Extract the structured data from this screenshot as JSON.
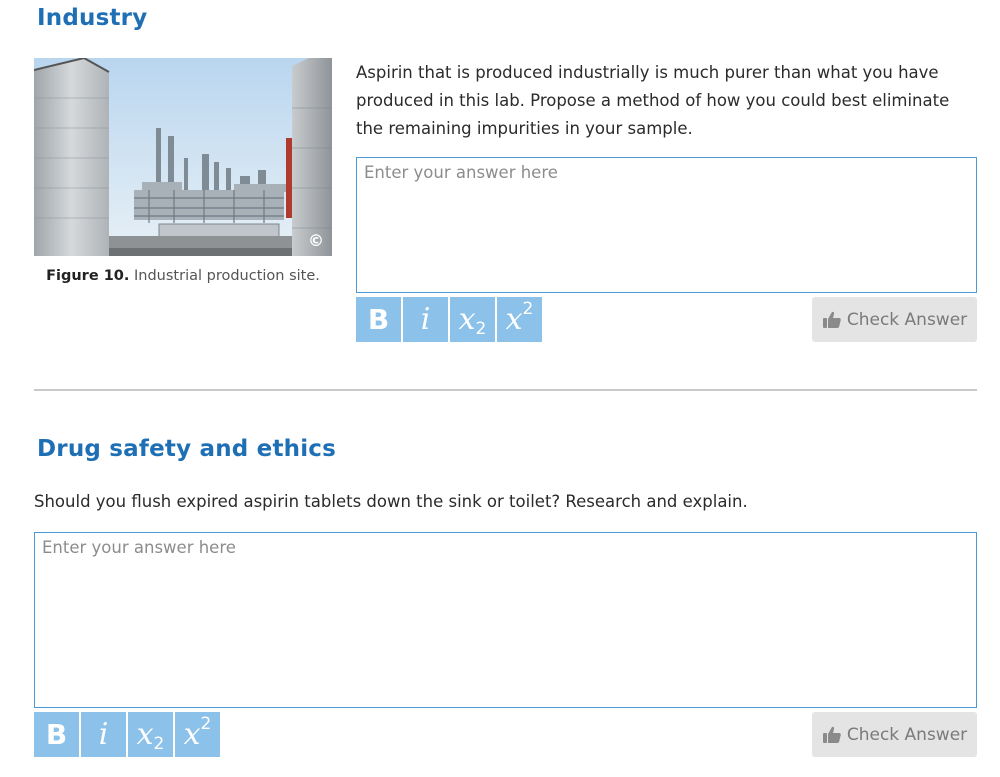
{
  "industry": {
    "heading": "Industry",
    "figure": {
      "copyright": "©",
      "caption_number": "Figure 10.",
      "caption_text": " Industrial production site."
    },
    "question": "Aspirin that is produced industrially is much purer than what you have produced in this lab. Propose a method of how you could best eliminate the remaining impurities in your sample.",
    "answer": {
      "value": "",
      "placeholder": "Enter your answer here"
    },
    "toolbar": {
      "bold": "B",
      "italic": "i",
      "subscript_base": "x",
      "subscript_mark": "2",
      "superscript_base": "x",
      "superscript_mark": "2"
    },
    "check_label": "Check Answer"
  },
  "drug_safety": {
    "heading": "Drug safety and ethics",
    "question": "Should you flush expired aspirin tablets down the sink or toilet? Research and explain.",
    "answer": {
      "value": "",
      "placeholder": "Enter your answer here"
    },
    "toolbar": {
      "bold": "B",
      "italic": "i",
      "subscript_base": "x",
      "subscript_mark": "2",
      "superscript_base": "x",
      "superscript_mark": "2"
    },
    "check_label": "Check Answer"
  },
  "colors": {
    "heading": "#1f6fb5",
    "format_button": "#8cc1ea",
    "answer_border": "#4a9ad9",
    "check_button": "#e4e4e4"
  },
  "icons": {
    "check_button": "thumbs-up-icon"
  }
}
